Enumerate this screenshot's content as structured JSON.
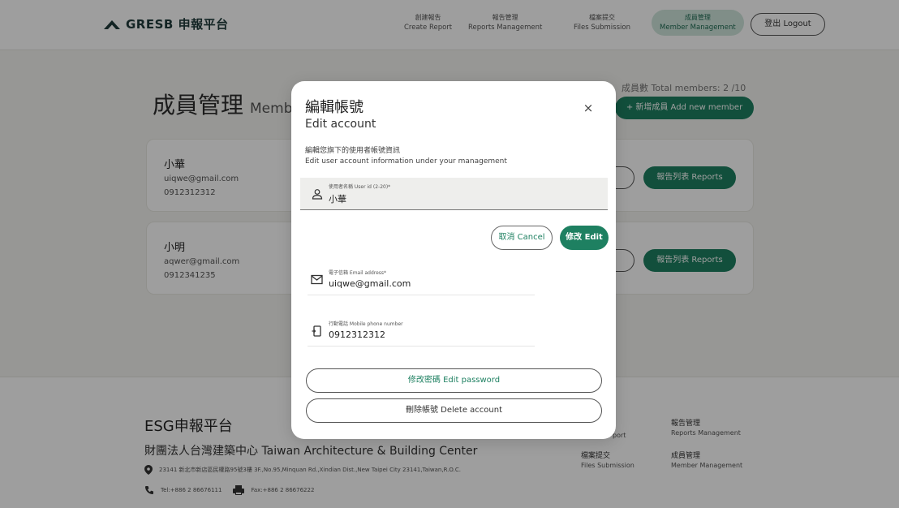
{
  "brand": {
    "name": "GRESB 申報平台"
  },
  "nav": [
    {
      "zh": "創建報告",
      "en": "Create Report"
    },
    {
      "zh": "報告管理",
      "en": "Reports Management"
    },
    {
      "zh": "檔案提交",
      "en": "Files Submission"
    },
    {
      "zh": "成員管理",
      "en": "Member Management"
    }
  ],
  "header": {
    "logout_label": "登出 Logout"
  },
  "page": {
    "title": "成員管理",
    "title_en_partial": "Membe",
    "member_count": "成員數 Total members: 2 /10",
    "add_member_label": "+ 新增成員 Add new member"
  },
  "members": [
    {
      "name": "小華",
      "email": "uiqwe@gmail.com",
      "phone": "0912312312",
      "reports_label": "報告列表 Reports"
    },
    {
      "name": "小明",
      "email": "aqwer@gmail.com",
      "phone": "0912341235",
      "reports_label": "報告列表 Reports"
    }
  ],
  "footer": {
    "title": "ESG申報平台",
    "org": "財團法人台灣建築中心 Taiwan Architecture & Building Center",
    "address": "23141 新北市新店區民權路95號3樓 3F.,No.95,Minquan Rd.,Xindian Dist.,New Taipei City 23141,Taiwan,R.O.C.",
    "tel": "Tel:+886 2 86676111",
    "fax": "Fax:+886 2 86676222",
    "links": [
      {
        "zh": "",
        "en": "port"
      },
      {
        "zh": "報告管理",
        "en": "Reports Management"
      },
      {
        "zh": "檔案提交",
        "en": "Files Submission"
      },
      {
        "zh": "成員管理",
        "en": "Member Management"
      }
    ]
  },
  "modal": {
    "title_zh": "編輯帳號",
    "title_en": "Edit account",
    "close_symbol": "×",
    "desc_zh": "編輯您旗下的使用者帳號資訊",
    "desc_en": "Edit user account information under your management",
    "user_id": {
      "label": "使用者名稱 User id (2-20)*",
      "value": "小華"
    },
    "cancel_label": "取消 Cancel",
    "edit_label": "修改 Edit",
    "email": {
      "label": "電子信箱 Email address*",
      "value": "uiqwe@gmail.com"
    },
    "phone": {
      "label": "行動電話 Mobile phone number",
      "value": "0912312312"
    },
    "edit_password_label": "修改密碼 Edit password",
    "delete_account_label": "刪除帳號 Delete account"
  },
  "colors": {
    "primary": "#1e8061",
    "active_nav_bg": "#cfe6dc"
  },
  "icons": [
    "cloud-logo-icon",
    "user-icon",
    "mail-icon",
    "phone-icon",
    "location-pin-icon",
    "telephone-icon",
    "fax-icon",
    "close-icon"
  ]
}
